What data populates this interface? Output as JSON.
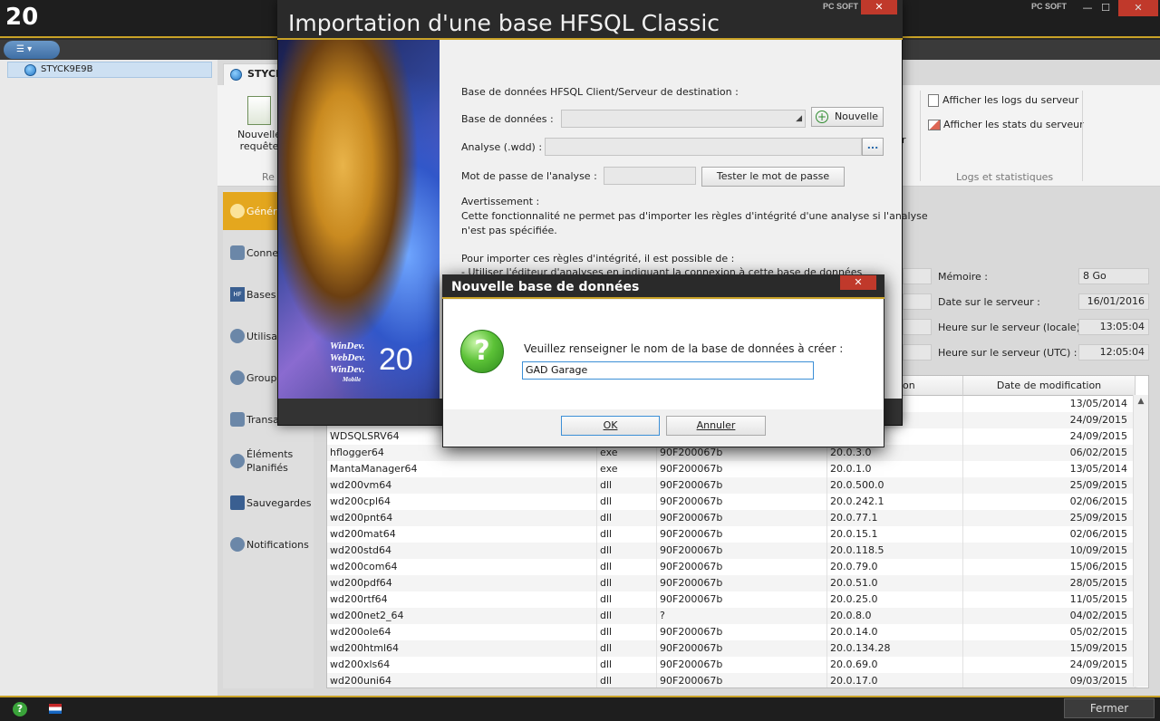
{
  "app": {
    "logo": "20",
    "brand": "PC SOFT"
  },
  "window_controls": {
    "minimize": "—",
    "maximize": "☐",
    "close": "✕"
  },
  "tree": {
    "server": "STYCK9E9B"
  },
  "server_tab": "STYCK",
  "ribbon": {
    "new_request": "Nouvelle",
    "new_request_line2": "requête",
    "group_req": "Re",
    "show_logs": "Afficher les logs du serveur",
    "show_stats": "Afficher les stats du serveur",
    "group_logs": "Logs et statistiques",
    "partial_r": "r"
  },
  "nav": [
    {
      "label": "Généra"
    },
    {
      "label": "Conne"
    },
    {
      "label": "Bases"
    },
    {
      "label": "Utilisat"
    },
    {
      "label": "Groupe"
    },
    {
      "label": "Transa"
    },
    {
      "label": "Éléments",
      "label2": "Planifiés"
    },
    {
      "label": "Sauvegardes"
    },
    {
      "label": "Notifications"
    }
  ],
  "info": {
    "memory_label": "Mémoire :",
    "memory_value": "8 Go",
    "date_label": "Date sur le serveur :",
    "date_value": "16/01/2016",
    "time_local_label": "Heure sur le serveur (locale) :",
    "time_local_value": "13:05:04",
    "time_utc_label": "Heure sur le serveur (UTC) :",
    "time_utc_value": "12:05:04"
  },
  "table": {
    "columns": [
      "",
      "",
      "",
      "ion",
      "Date de modification"
    ],
    "rows": [
      [
        "",
        "",
        "",
        "",
        "13/05/2014"
      ],
      [
        "",
        "",
        "",
        "",
        "24/09/2015"
      ],
      [
        "WDSQLSRV64",
        "",
        "",
        "",
        "24/09/2015"
      ],
      [
        "hflogger64",
        "exe",
        "90F200067b",
        "20.0.3.0",
        "06/02/2015"
      ],
      [
        "MantaManager64",
        "exe",
        "90F200067b",
        "20.0.1.0",
        "13/05/2014"
      ],
      [
        "wd200vm64",
        "dll",
        "90F200067b",
        "20.0.500.0",
        "25/09/2015"
      ],
      [
        "wd200cpl64",
        "dll",
        "90F200067b",
        "20.0.242.1",
        "02/06/2015"
      ],
      [
        "wd200pnt64",
        "dll",
        "90F200067b",
        "20.0.77.1",
        "25/09/2015"
      ],
      [
        "wd200mat64",
        "dll",
        "90F200067b",
        "20.0.15.1",
        "02/06/2015"
      ],
      [
        "wd200std64",
        "dll",
        "90F200067b",
        "20.0.118.5",
        "10/09/2015"
      ],
      [
        "wd200com64",
        "dll",
        "90F200067b",
        "20.0.79.0",
        "15/06/2015"
      ],
      [
        "wd200pdf64",
        "dll",
        "90F200067b",
        "20.0.51.0",
        "28/05/2015"
      ],
      [
        "wd200rtf64",
        "dll",
        "90F200067b",
        "20.0.25.0",
        "11/05/2015"
      ],
      [
        "wd200net2_64",
        "dll",
        "?",
        "20.0.8.0",
        "04/02/2015"
      ],
      [
        "wd200ole64",
        "dll",
        "90F200067b",
        "20.0.14.0",
        "05/02/2015"
      ],
      [
        "wd200html64",
        "dll",
        "90F200067b",
        "20.0.134.28",
        "15/09/2015"
      ],
      [
        "wd200xls64",
        "dll",
        "90F200067b",
        "20.0.69.0",
        "24/09/2015"
      ],
      [
        "wd200uni64",
        "dll",
        "90F200067b",
        "20.0.17.0",
        "09/03/2015"
      ]
    ]
  },
  "bottom": {
    "close_label": "Fermer"
  },
  "import_dialog": {
    "title": "Importation d'une base HFSQL Classic",
    "art_brand1": "WinDev.",
    "art_brand2": "WebDev.",
    "art_brand3": "WinDev.",
    "art_brand4": "Mobile",
    "art_num": "20",
    "dest_heading": "Base de données HFSQL Client/Serveur de destination :",
    "db_label": "Base de données :",
    "new_btn": "Nouvelle",
    "analysis_label": "Analyse (.wdd) :",
    "browse_btn": "...",
    "pwd_label": "Mot de passe de l'analyse :",
    "test_pwd_btn": "Tester le mot de passe",
    "warning_title": "Avertissement :",
    "warning_l1": "Cette fonctionnalité ne permet pas d'importer les règles d'intégrité d'une analyse si l'analyse",
    "warning_l2": "n'est pas spécifiée.",
    "import_rules": "Pour importer ces règles d'intégrité, il est possible de :",
    "import_rules_l2": "- Utiliser l'éditeur d'analyses en indiquant la connexion à cette base de données"
  },
  "modal": {
    "title": "Nouvelle base de données",
    "prompt": "Veuillez renseigner le nom de la base de données à créer :",
    "value": "GAD Garage",
    "ok": "OK",
    "cancel": "Annuler"
  }
}
